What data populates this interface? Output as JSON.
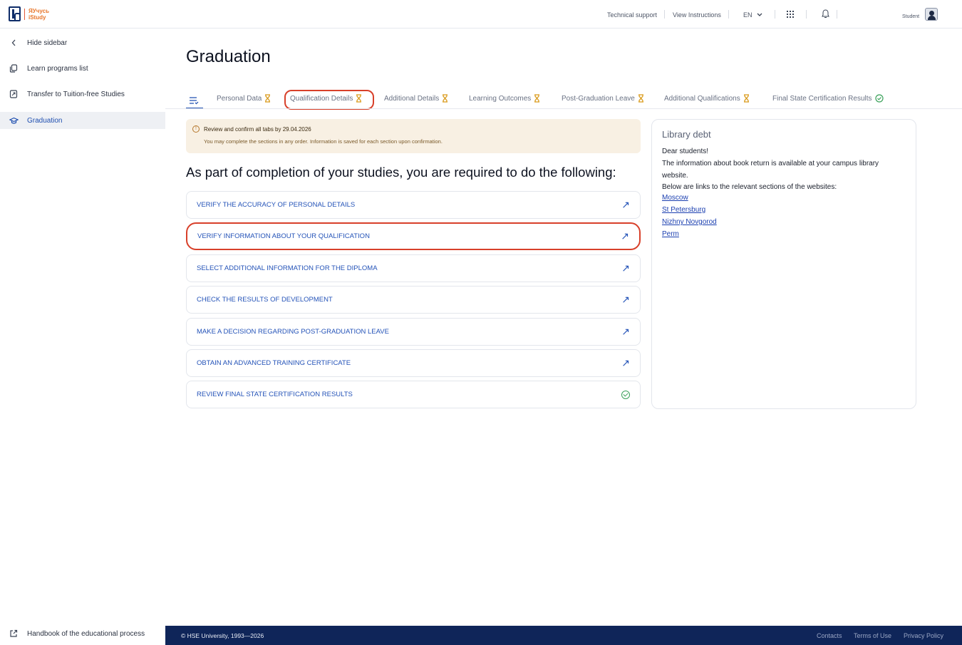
{
  "header": {
    "logo_text_ru": "ЯУчусь",
    "logo_text_en": "iStudy",
    "technical_support": "Technical support",
    "view_instructions": "View Instructions",
    "language": "EN",
    "user_role": "Student"
  },
  "sidebar": {
    "hide": "Hide sidebar",
    "items": [
      {
        "label": "Learn programs list",
        "icon": "copy-icon"
      },
      {
        "label": "Transfer to Tuition-free Studies",
        "icon": "document-transfer-icon"
      },
      {
        "label": "Graduation",
        "icon": "graduation-cap-icon",
        "active": true
      }
    ],
    "footer_link": "Handbook of the educational process"
  },
  "main": {
    "title": "Graduation",
    "tabs": [
      {
        "label": "Personal Data",
        "status": "pending"
      },
      {
        "label": "Qualification Details",
        "status": "pending",
        "highlighted": true
      },
      {
        "label": "Additional Details",
        "status": "pending"
      },
      {
        "label": "Learning Outcomes",
        "status": "pending"
      },
      {
        "label": "Post-Graduation Leave",
        "status": "pending"
      },
      {
        "label": "Additional Qualifications",
        "status": "pending"
      },
      {
        "label": "Final State Certification Results",
        "status": "done"
      }
    ],
    "notice": {
      "title": "Review and confirm all tabs by 29.04.2026",
      "subtitle": "You may complete the sections in any order. Information is saved for each section upon confirmation."
    },
    "heading": "As part of completion of your studies, you are required to do the following:",
    "tasks": [
      {
        "label": "VERIFY THE ACCURACY OF PERSONAL DETAILS",
        "status": "open"
      },
      {
        "label": "VERIFY INFORMATION ABOUT YOUR QUALIFICATION",
        "status": "open",
        "highlighted": true
      },
      {
        "label": "SELECT ADDITIONAL INFORMATION FOR THE DIPLOMA",
        "status": "open"
      },
      {
        "label": "CHECK THE RESULTS OF DEVELOPMENT",
        "status": "open"
      },
      {
        "label": "MAKE A DECISION REGARDING POST-GRADUATION LEAVE",
        "status": "open"
      },
      {
        "label": "OBTAIN AN ADVANCED TRAINING CERTIFICATE",
        "status": "open"
      },
      {
        "label": "REVIEW FINAL STATE CERTIFICATION RESULTS",
        "status": "done"
      }
    ]
  },
  "library": {
    "title": "Library debt",
    "line1": "Dear students!",
    "line2": "The information about book return is available at your campus library website.",
    "line3": "Below are links to the relevant sections of the websites:",
    "links": [
      "Moscow",
      "St Petersburg",
      "Nizhny Novgorod",
      "Perm"
    ]
  },
  "footer": {
    "copyright": "© HSE University, 1993—2026",
    "contacts": "Contacts",
    "terms": "Terms of Use",
    "privacy": "Privacy Policy"
  },
  "colors": {
    "accent": "#1f4fb0",
    "pending": "#d99a1a",
    "done": "#3aa15a",
    "highlight": "#d8402a",
    "footer_bg": "#0f2559"
  }
}
